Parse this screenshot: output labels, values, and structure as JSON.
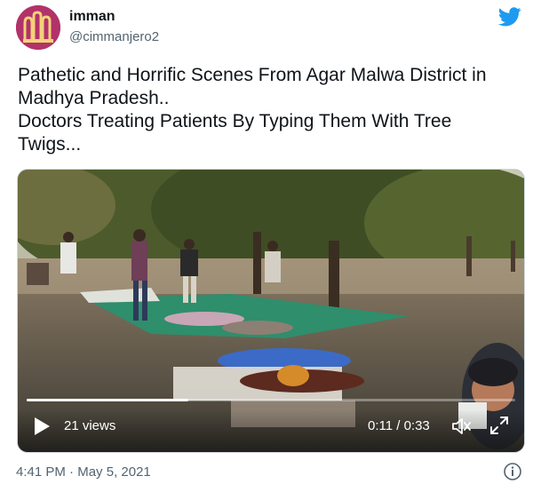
{
  "tweet": {
    "author": {
      "display_name": "imman",
      "handle": "@cimmanjero2"
    },
    "text_lines": [
      "Pathetic and Horrific Scenes From Agar Malwa District in",
      "Madhya Pradesh..",
      "Doctors Treating Patients By Typing Them With Tree",
      "Twigs..."
    ],
    "timestamp": {
      "time": "4:41 PM",
      "separator": "·",
      "date": "May 5, 2021"
    }
  },
  "video": {
    "views": "21 views",
    "time": "0:11 / 0:33",
    "progress_fraction": 0.33
  },
  "colors": {
    "twitter_blue": "#1d9bf0",
    "avatar_bg": "#b2326a",
    "text_primary": "#0f1419",
    "text_secondary": "#536471"
  },
  "icons": {
    "logo": "twitter-bird-icon",
    "play": "play-icon",
    "volume": "volume-icon",
    "fullscreen": "fullscreen-icon",
    "info": "info-icon"
  }
}
